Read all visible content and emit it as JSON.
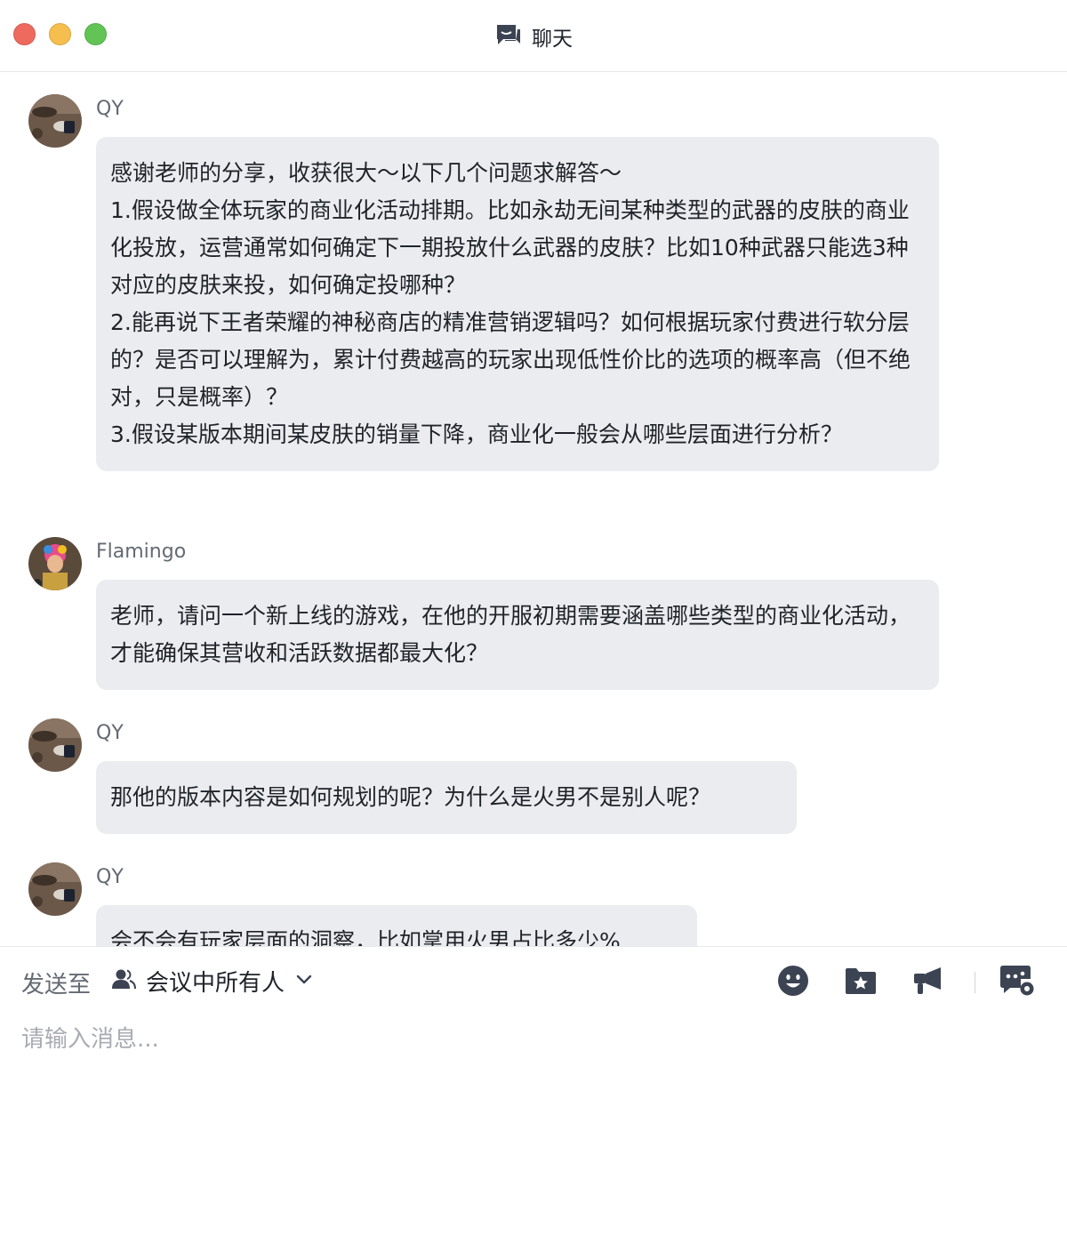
{
  "window": {
    "title": "聊天"
  },
  "messages": [
    {
      "sender": "QY",
      "avatar": "photo-avatar",
      "text": "感谢老师的分享，收获很大～以下几个问题求解答～\n1.假设做全体玩家的商业化活动排期。比如永劫无间某种类型的武器的皮肤的商业化投放，运营通常如何确定下一期投放什么武器的皮肤？比如10种武器只能选3种对应的皮肤来投，如何确定投哪种？\n2.能再说下王者荣耀的神秘商店的精准营销逻辑吗？如何根据玩家付费进行软分层的？是否可以理解为，累计付费越高的玩家出现低性价比的选项的概率高（但不绝对，只是概率）？\n3.假设某版本期间某皮肤的销量下降，商业化一般会从哪些层面进行分析？"
    },
    {
      "sender": "Flamingo",
      "avatar": "photo-avatar",
      "text": "老师，请问一个新上线的游戏，在他的开服初期需要涵盖哪些类型的商业化活动，才能确保其营收和活跃数据都最大化？"
    },
    {
      "sender": "QY",
      "avatar": "photo-avatar",
      "text": "那他的版本内容是如何规划的呢？为什么是火男不是别人呢？"
    },
    {
      "sender": "QY",
      "avatar": "photo-avatar",
      "text": "会不会有玩家层面的洞察，比如掌用火男占比多少%"
    }
  ],
  "composer": {
    "send_to_label": "发送至",
    "send_to_target": "会议中所有人",
    "placeholder": "请输入消息...",
    "tools": [
      "emoji-icon",
      "folder-star-icon",
      "megaphone-icon",
      "chat-settings-icon"
    ]
  },
  "colors": {
    "bubble_bg": "#ebecf0",
    "icon_dark": "#3c4353",
    "close": "#ee6a5e",
    "minimize": "#f5be4f",
    "maximize": "#61c454"
  }
}
